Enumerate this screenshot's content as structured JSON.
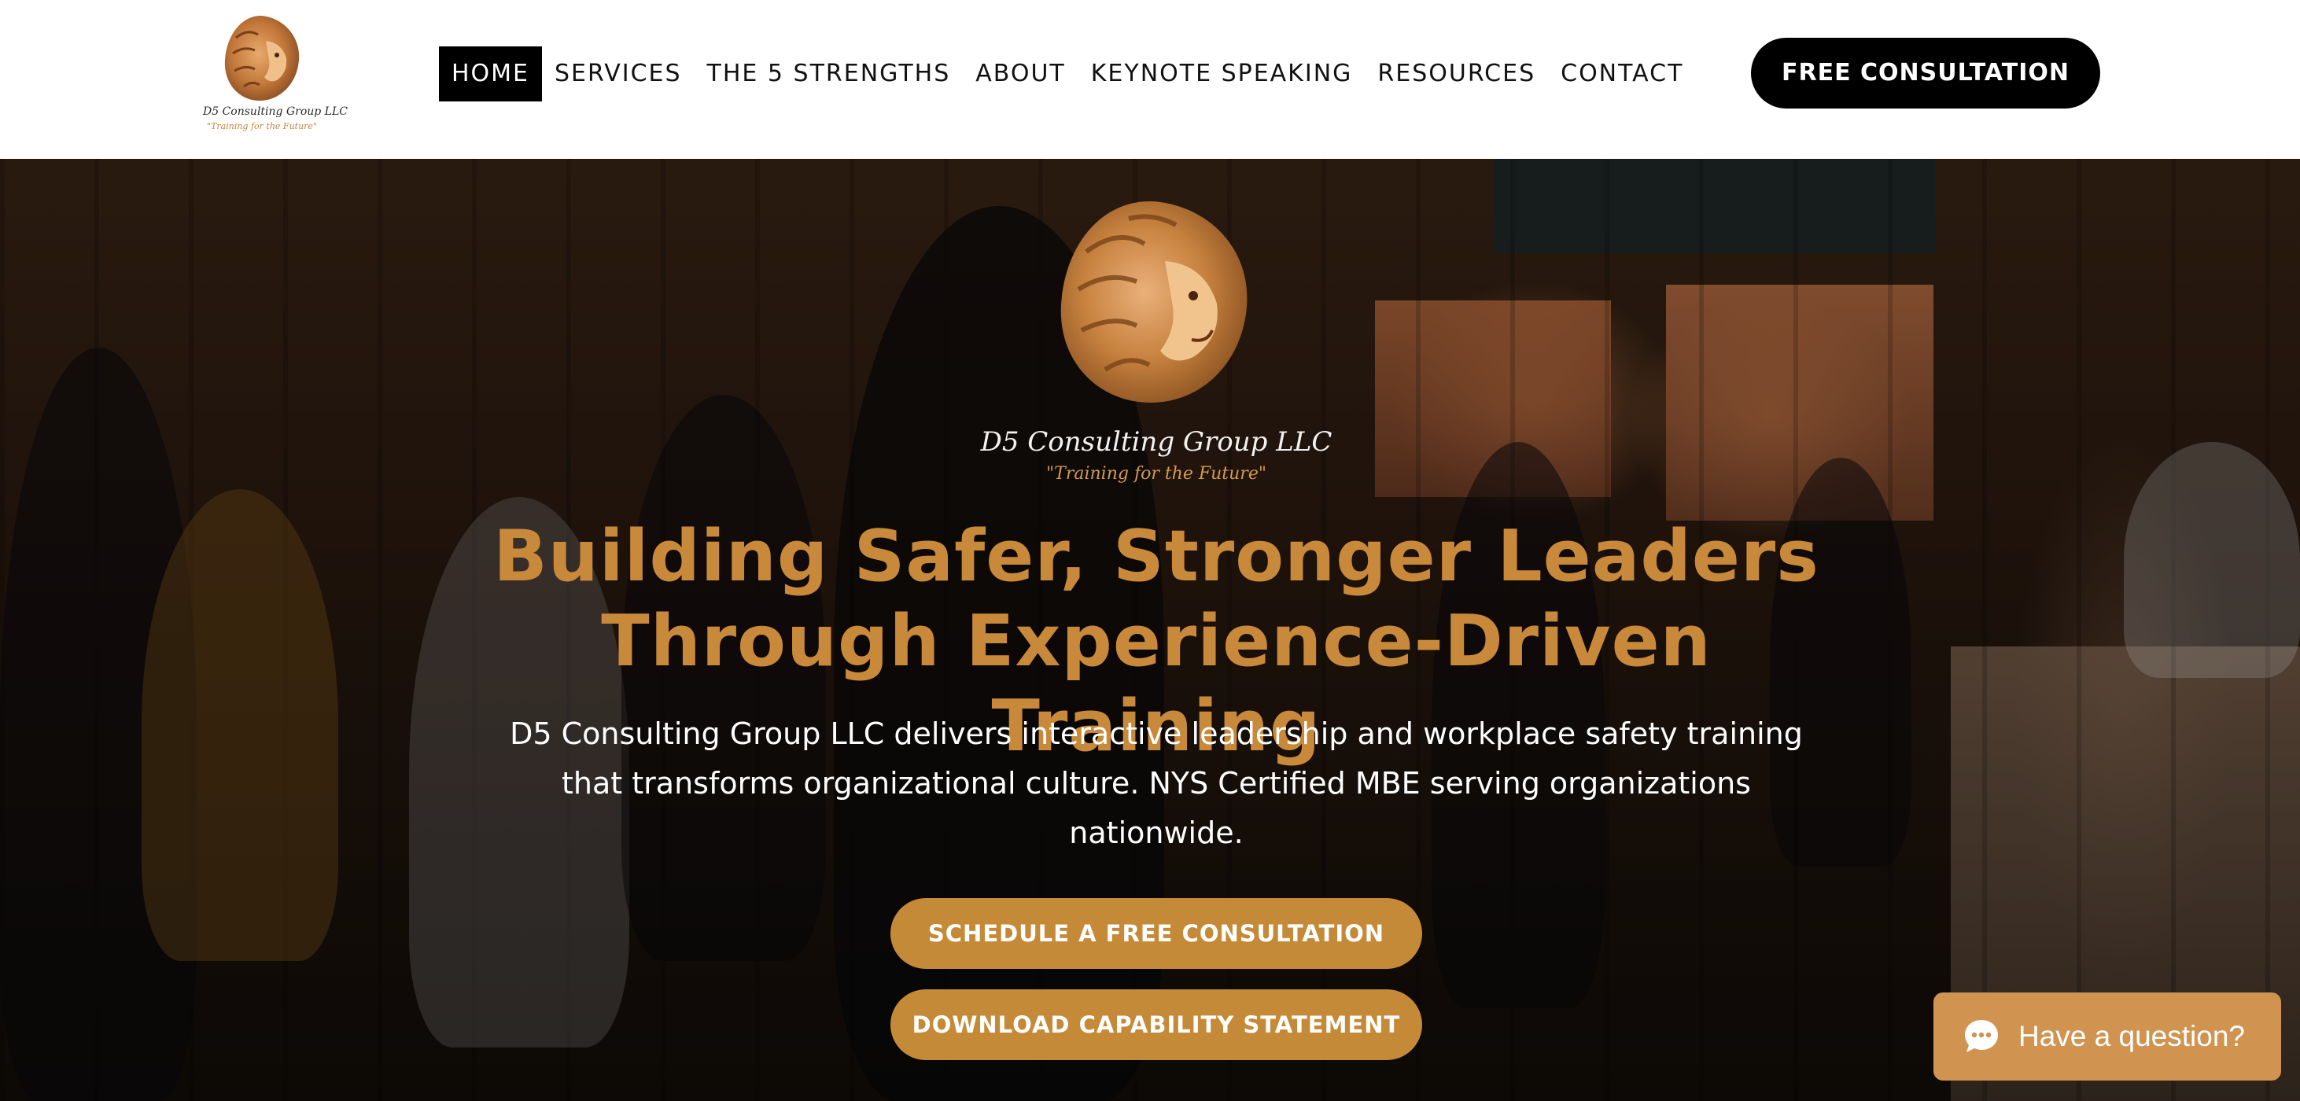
{
  "brand": {
    "name": "D5 Consulting Group LLC",
    "tagline": "\"Training for the Future\"",
    "accent_color": "#c9893a"
  },
  "header": {
    "nav": [
      {
        "label": "HOME",
        "active": true
      },
      {
        "label": "SERVICES",
        "active": false
      },
      {
        "label": "THE 5 STRENGTHS",
        "active": false
      },
      {
        "label": "ABOUT",
        "active": false
      },
      {
        "label": "KEYNOTE SPEAKING",
        "active": false
      },
      {
        "label": "RESOURCES",
        "active": false
      },
      {
        "label": "CONTACT",
        "active": false
      }
    ],
    "cta_label": "FREE CONSULTATION"
  },
  "hero": {
    "title_line1": "Building Safer, Stronger Leaders",
    "title_line2": "Through Experience-Driven Training",
    "description": "D5 Consulting Group LLC delivers interactive leadership and workplace safety training that transforms organizational culture. NYS Certified MBE serving organizations nationwide.",
    "primary_button": "SCHEDULE A FREE CONSULTATION",
    "secondary_button": "DOWNLOAD CAPABILITY STATEMENT"
  },
  "chat": {
    "label": "Have a question?",
    "icon": "chat-bubble-icon"
  }
}
